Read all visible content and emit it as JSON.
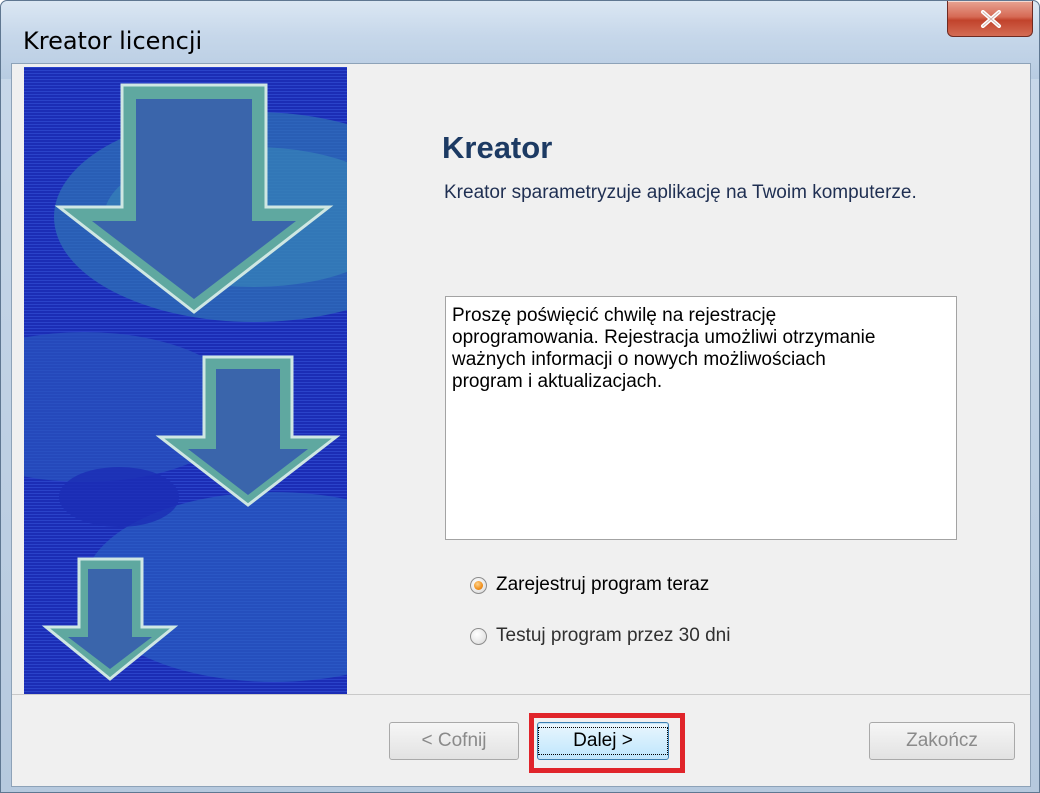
{
  "window": {
    "title": "Kreator licencji"
  },
  "content": {
    "heading": "Kreator",
    "subtitle": "Kreator sparametryzuje aplikację na Twoim komputerze.",
    "info_text": "Proszę poświęcić chwilę na rejestrację\noprogramowania. Rejestracja umożliwi otrzymanie\nważnych informacji o nowych możliwościach\nprogram i aktualizacjach."
  },
  "options": {
    "register_now": {
      "label": "Zarejestruj program teraz",
      "checked": true
    },
    "trial": {
      "label": "Testuj program przez 30 dni",
      "checked": false
    }
  },
  "buttons": {
    "back_label": "< Cofnij",
    "next_label": "Dalej >",
    "finish_label": "Zakończ"
  },
  "icons": {
    "close": "close-icon",
    "side_art": "download-arrows-icon"
  },
  "colors": {
    "side_art_bg": "#1b2db5",
    "arrow_fill": "#5fa8a0",
    "highlight": "#e0242a",
    "heading": "#1c3a63"
  }
}
